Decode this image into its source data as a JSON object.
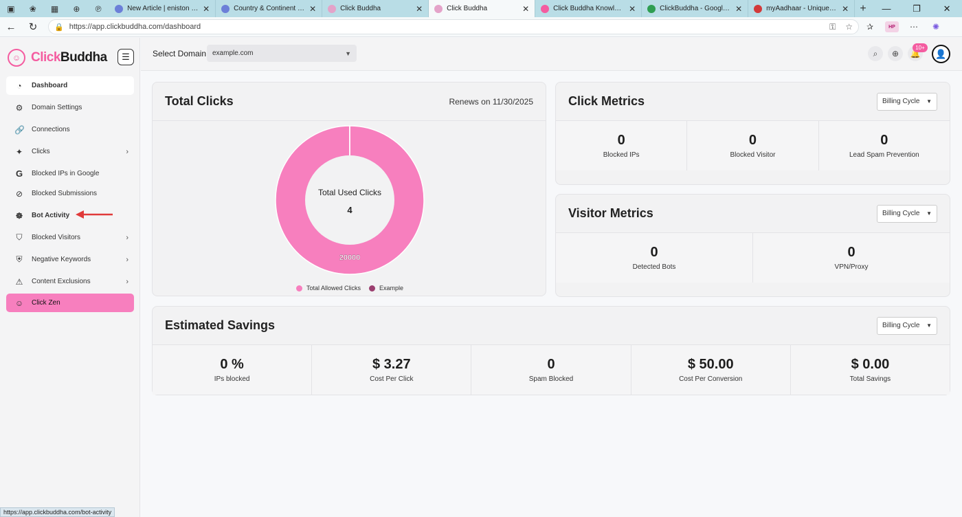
{
  "browser": {
    "tabs": [
      {
        "title": "New Article | eniston Knowle",
        "color": "#6c7fd8"
      },
      {
        "title": "Country & Continent Securit",
        "color": "#6c7fd8"
      },
      {
        "title": "Click Buddha",
        "color": "#e4a3c9"
      },
      {
        "title": "Click Buddha",
        "color": "#e4a3c9",
        "active": true
      },
      {
        "title": "Click Buddha Knowledge Ba",
        "color": "#f45ca0"
      },
      {
        "title": "ClickBuddha - Google Drive",
        "color": "#2f9e52"
      },
      {
        "title": "myAadhaar - Unique Identific",
        "color": "#d23a3a"
      }
    ],
    "url": "https://app.clickbuddha.com/dashboard",
    "profile": "HP",
    "status_url": "https://app.clickbuddha.com/bot-activity"
  },
  "brand": {
    "part1": "Click",
    "part2": "Buddha"
  },
  "sidebar": {
    "items": [
      {
        "label": "Dashboard",
        "icon": "dashboard-icon",
        "glyph": "◔",
        "active": true
      },
      {
        "label": "Domain Settings",
        "icon": "gear-icon",
        "glyph": "⚙"
      },
      {
        "label": "Connections",
        "icon": "link-icon",
        "glyph": "🔗"
      },
      {
        "label": "Clicks",
        "icon": "click-icon",
        "glyph": "✦",
        "chevron": true
      },
      {
        "label": "Blocked IPs in Google",
        "icon": "google-icon",
        "glyph": "G"
      },
      {
        "label": "Blocked Submissions",
        "icon": "block-icon",
        "glyph": "⊘"
      },
      {
        "label": "Bot Activity",
        "icon": "bot-icon",
        "glyph": "☸",
        "bold": true
      },
      {
        "label": "Blocked Visitors",
        "icon": "shield-icon",
        "glyph": "⛉",
        "chevron": true
      },
      {
        "label": "Negative Keywords",
        "icon": "shield-minus-icon",
        "glyph": "⛨",
        "chevron": true
      },
      {
        "label": "Content Exclusions",
        "icon": "warning-icon",
        "glyph": "⚠",
        "chevron": true
      },
      {
        "label": "Click Zen",
        "icon": "buddha-icon",
        "glyph": "☺",
        "zen": true
      }
    ]
  },
  "topbar": {
    "select_label": "Select Domain",
    "select_value": "example.com",
    "notifications_badge": "10+"
  },
  "total_clicks": {
    "title": "Total Clicks",
    "renews": "Renews on 11/30/2025",
    "center_label": "Total Used Clicks",
    "center_value": "4",
    "slice_label": "20000",
    "legend": [
      {
        "label": "Total Allowed Clicks",
        "color": "#f77fbe"
      },
      {
        "label": "Example",
        "color": "#9b3e6f"
      }
    ]
  },
  "chart_data": {
    "type": "pie",
    "categories": [
      "Total Allowed Clicks",
      "Example"
    ],
    "values": [
      20000,
      4
    ],
    "colors": [
      "#f77fbe",
      "#9b3e6f"
    ],
    "title": "",
    "legend": "bottom"
  },
  "click_metrics": {
    "title": "Click Metrics",
    "billing": "Billing Cycle",
    "items": [
      {
        "value": "0",
        "label": "Blocked IPs"
      },
      {
        "value": "0",
        "label": "Blocked Visitor"
      },
      {
        "value": "0",
        "label": "Lead Spam Prevention"
      }
    ]
  },
  "visitor_metrics": {
    "title": "Visitor Metrics",
    "billing": "Billing Cycle",
    "items": [
      {
        "value": "0",
        "label": "Detected Bots"
      },
      {
        "value": "0",
        "label": "VPN/Proxy"
      }
    ]
  },
  "savings": {
    "title": "Estimated Savings",
    "billing": "Billing Cycle",
    "items": [
      {
        "value": "0 %",
        "label": "IPs blocked"
      },
      {
        "value": "$ 3.27",
        "label": "Cost Per Click"
      },
      {
        "value": "0",
        "label": "Spam Blocked"
      },
      {
        "value": "$ 50.00",
        "label": "Cost Per Conversion"
      },
      {
        "value": "$ 0.00",
        "label": "Total Savings"
      }
    ]
  },
  "colors": {
    "brand_pink": "#f45ca0",
    "zen_pink": "#f77fbe",
    "arrow_red": "#e03a3a"
  }
}
